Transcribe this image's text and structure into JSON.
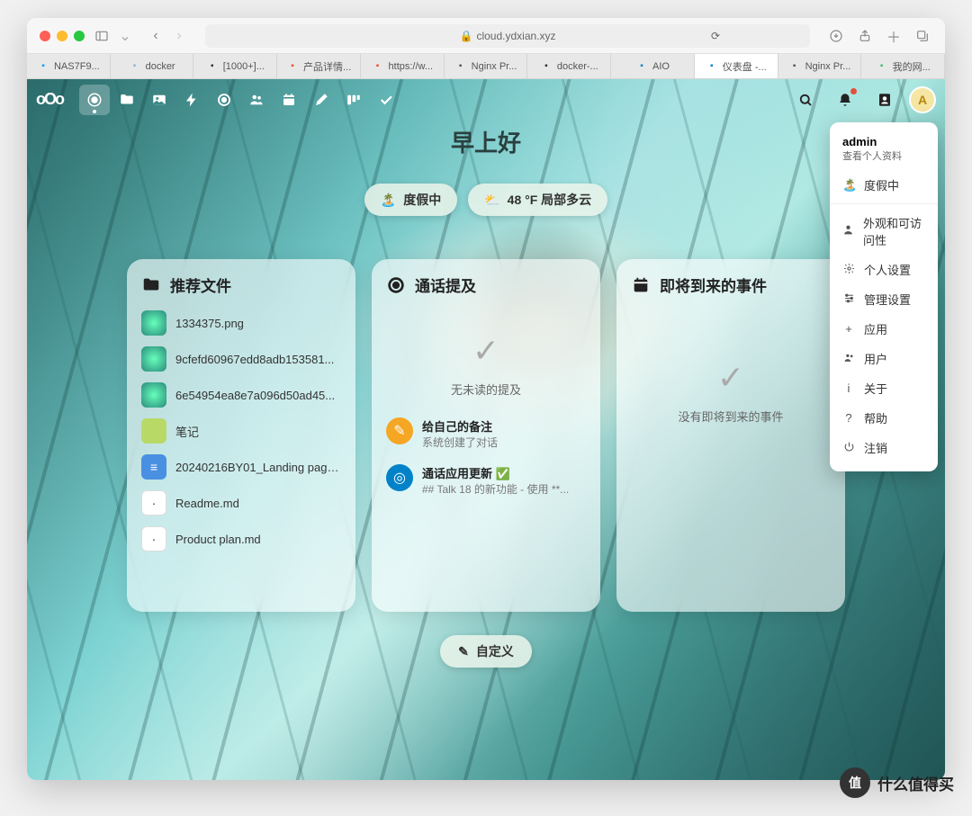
{
  "browser": {
    "url": "cloud.ydxian.xyz",
    "tabs": [
      {
        "label": "NAS7F9...",
        "favColor": "#0099ff"
      },
      {
        "label": "docker",
        "favColor": "#7db9e8"
      },
      {
        "label": "[1000+]...",
        "favColor": "#333"
      },
      {
        "label": "产品详情...",
        "favColor": "#e74c3c"
      },
      {
        "label": "https://w...",
        "favColor": "#e74c3c"
      },
      {
        "label": "Nginx Pr...",
        "favColor": "#555"
      },
      {
        "label": "docker-...",
        "favColor": "#333"
      },
      {
        "label": "AIO",
        "favColor": "#0082c9"
      },
      {
        "label": "仪表盘 -...",
        "favColor": "#0082c9",
        "active": true
      },
      {
        "label": "Nginx Pr...",
        "favColor": "#555"
      },
      {
        "label": "我的网...",
        "favColor": "#48bb78"
      }
    ]
  },
  "greeting": "早上好",
  "status": {
    "vacation": "度假中",
    "weather": "48 °F 局部多云"
  },
  "widgets": {
    "files": {
      "title": "推荐文件",
      "items": [
        {
          "name": "1334375.png",
          "type": "img"
        },
        {
          "name": "9cfefd60967edd8adb153581...",
          "type": "img"
        },
        {
          "name": "6e54954ea8e7a096d50ad45...",
          "type": "img"
        },
        {
          "name": "笔记",
          "type": "fold"
        },
        {
          "name": "20240216BY01_Landing page...",
          "type": "doc"
        },
        {
          "name": "Readme.md",
          "type": "md"
        },
        {
          "name": "Product plan.md",
          "type": "md"
        }
      ]
    },
    "talk": {
      "title": "通话提及",
      "empty": "无未读的提及",
      "items": [
        {
          "title": "给自己的备注",
          "sub": "系统创建了对话",
          "icon": "note"
        },
        {
          "title": "通话应用更新 ✅",
          "sub": "## Talk 18 的新功能 - 使用 **...",
          "icon": "app"
        }
      ]
    },
    "events": {
      "title": "即将到来的事件",
      "empty": "没有即将到来的事件"
    }
  },
  "customize": "自定义",
  "usermenu": {
    "name": "admin",
    "sub": "查看个人资料",
    "items": [
      {
        "icon": "🏝️",
        "label": "度假中"
      },
      {
        "icon": "person",
        "label": "外观和可访问性"
      },
      {
        "icon": "gear",
        "label": "个人设置"
      },
      {
        "icon": "admin",
        "label": "管理设置"
      },
      {
        "icon": "+",
        "label": "应用"
      },
      {
        "icon": "users",
        "label": "用户"
      },
      {
        "icon": "i",
        "label": "关于"
      },
      {
        "icon": "?",
        "label": "帮助"
      },
      {
        "icon": "power",
        "label": "注销"
      }
    ]
  },
  "avatar_letter": "A",
  "watermark": {
    "circle": "值",
    "text": "什么值得买"
  }
}
